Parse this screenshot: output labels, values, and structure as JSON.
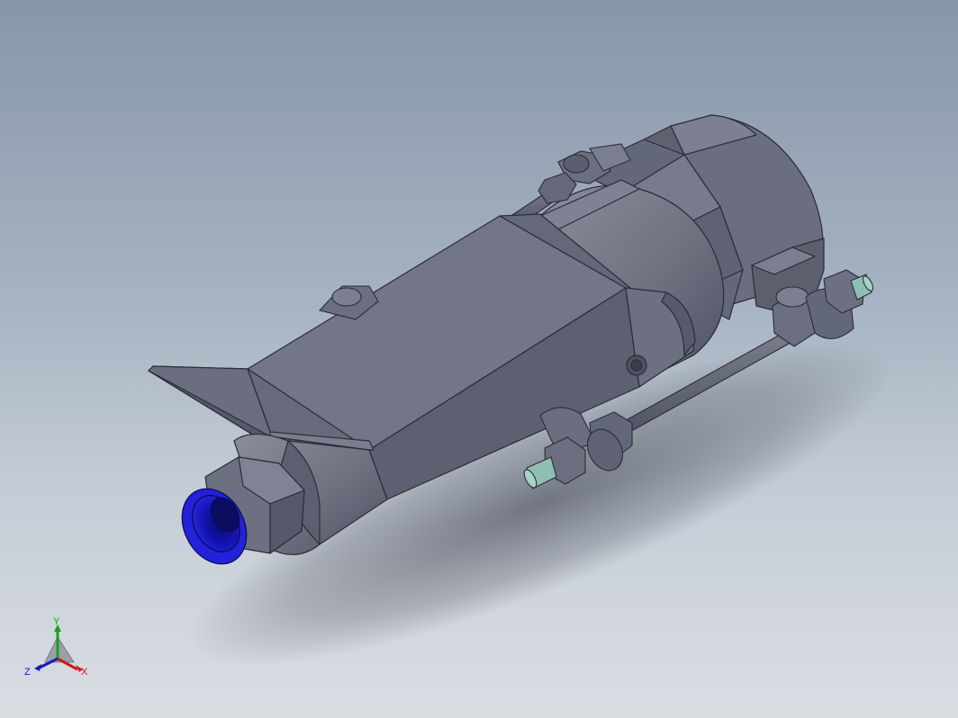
{
  "viewport": {
    "background_top": "#8796a9",
    "background_bottom": "#dadee3",
    "part_color": "#6e7282",
    "fitting_color": "#1818c8",
    "pin_color": "#8fbfb3"
  },
  "triad": {
    "x_label": "X",
    "y_label": "Y",
    "z_label": "Z",
    "x_color": "#d01818",
    "y_color": "#18a018",
    "z_color": "#1818c0"
  }
}
